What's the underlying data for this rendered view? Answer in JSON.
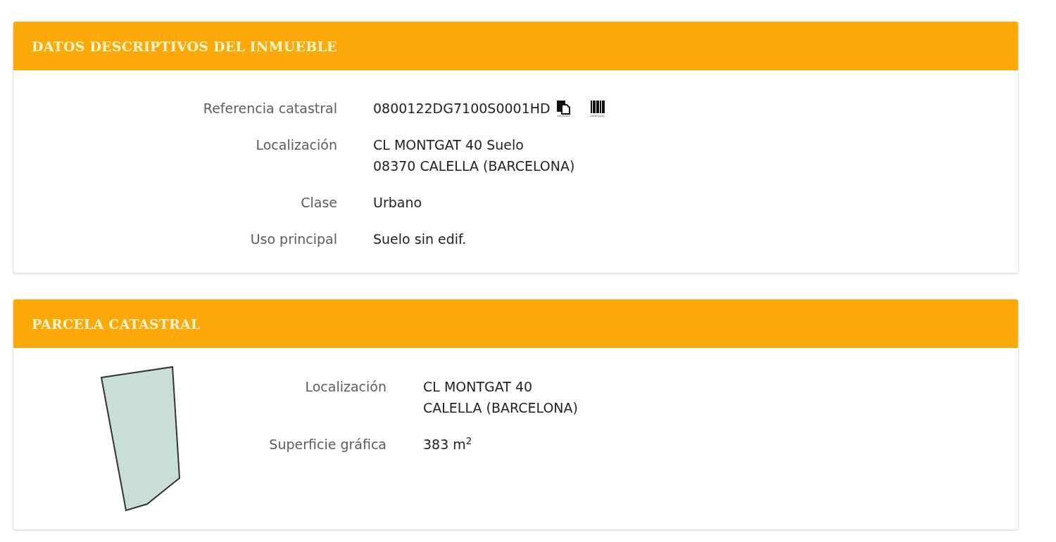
{
  "sections": [
    {
      "title": "DATOS DESCRIPTIVOS DEL INMUEBLE",
      "rows": [
        {
          "label": "Referencia catastral",
          "lines": [
            "0800122DG7100S0001HD"
          ],
          "icons": true
        },
        {
          "label": "Localización",
          "lines": [
            "CL MONTGAT 40 Suelo",
            "08370 CALELLA (BARCELONA)"
          ]
        },
        {
          "label": "Clase",
          "lines": [
            "Urbano"
          ]
        },
        {
          "label": "Uso principal",
          "lines": [
            "Suelo sin edif."
          ]
        }
      ]
    },
    {
      "title": "PARCELA CATASTRAL",
      "plot": true,
      "rows": [
        {
          "label": "Localización",
          "lines": [
            "CL MONTGAT 40",
            "CALELLA (BARCELONA)"
          ]
        },
        {
          "label": "Superficie gráfica",
          "lines": [
            "383 m$^{2}$"
          ]
        }
      ]
    }
  ]
}
